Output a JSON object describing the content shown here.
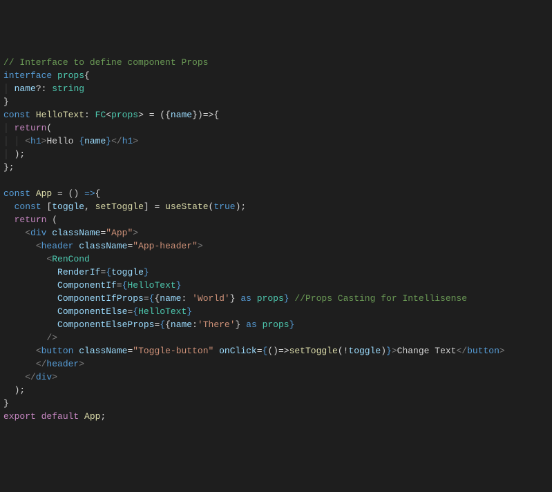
{
  "code": {
    "line1_comment": "// Interface to define component Props",
    "line2_interface": "interface",
    "line2_props": "props",
    "line3_name": "name",
    "line3_string": "string",
    "line5_const": "const",
    "line5_HelloText": "HelloText",
    "line5_FC": "FC",
    "line5_props": "props",
    "line5_name": "name",
    "line6_return": "return",
    "line7_h1": "h1",
    "line7_hello": "Hello ",
    "line7_name": "name",
    "line10_const": "const",
    "line10_App": "App",
    "line11_const": "const",
    "line11_toggle": "toggle",
    "line11_setToggle": "setToggle",
    "line11_useState": "useState",
    "line11_true": "true",
    "line12_return": "return",
    "line13_div": "div",
    "line13_className": "className",
    "line13_App": "\"App\"",
    "line14_header": "header",
    "line14_className": "className",
    "line14_AppHeader": "\"App-header\"",
    "line15_RenCond": "RenCond",
    "line16_RenderIf": "RenderIf",
    "line16_toggle": "toggle",
    "line17_ComponentIf": "ComponentIf",
    "line17_HelloText": "HelloText",
    "line18_ComponentIfProps": "ComponentIfProps",
    "line18_name": "name",
    "line18_World": "'World'",
    "line18_as": "as",
    "line18_props": "props",
    "line18_comment": "//Props Casting for Intellisense",
    "line19_ComponentElse": "ComponentElse",
    "line19_HelloText": "HelloText",
    "line20_ComponentElseProps": "ComponentElseProps",
    "line20_name": "name",
    "line20_There": "'There'",
    "line20_as": "as",
    "line20_props": "props",
    "line22_button": "button",
    "line22_className": "className",
    "line22_ToggleButton": "\"Toggle-button\"",
    "line22_onClick": "onClick",
    "line22_setToggle": "setToggle",
    "line22_toggle": "toggle",
    "line22_ChangeText": "Change Text",
    "line23_header": "header",
    "line24_div": "div",
    "line27_export": "export",
    "line27_default": "default",
    "line27_App": "App"
  }
}
